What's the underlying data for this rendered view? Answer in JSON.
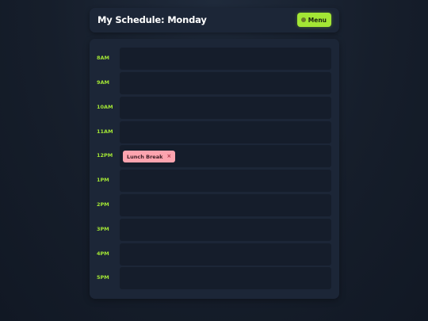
{
  "header": {
    "title": "My Schedule: Monday",
    "menu_label": "Menu",
    "menu_icon": "dot-icon",
    "accent_color": "#a3e635"
  },
  "schedule": {
    "rows": [
      {
        "time": "8AM"
      },
      {
        "time": "9AM"
      },
      {
        "time": "10AM"
      },
      {
        "time": "11AM"
      },
      {
        "time": "12PM",
        "event": {
          "title": "Lunch Break",
          "close": "×",
          "color": "#fda4af"
        }
      },
      {
        "time": "1PM"
      },
      {
        "time": "2PM"
      },
      {
        "time": "3PM"
      },
      {
        "time": "4PM"
      },
      {
        "time": "5PM"
      }
    ]
  }
}
